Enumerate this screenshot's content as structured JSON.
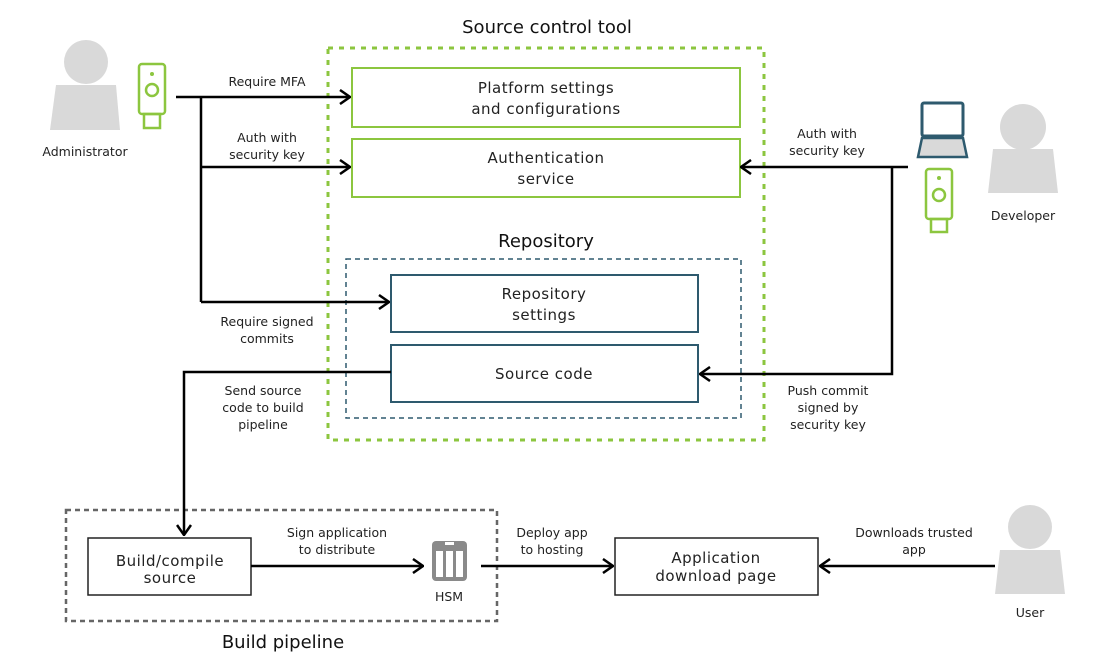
{
  "colors": {
    "green": "#8cc63f",
    "teal": "#2e5a6e",
    "gray_person": "#d9d9d9",
    "pipeline_border": "#666666",
    "hsm": "#8a8a8a"
  },
  "source_control": {
    "title": "Source control tool",
    "platform": [
      "Platform settings",
      "and configurations"
    ],
    "auth": [
      "Authentication",
      "service"
    ],
    "repository": {
      "title": "Repository",
      "settings": [
        "Repository",
        "settings"
      ],
      "source_code": "Source code"
    }
  },
  "build": {
    "title": "Build pipeline",
    "compile": [
      "Build/compile",
      "source"
    ],
    "hsm": "HSM"
  },
  "app_page": [
    "Application",
    "download page"
  ],
  "actors": {
    "admin": "Administrator",
    "developer": "Developer",
    "user": "User"
  },
  "edges": {
    "require_mfa": "Require MFA",
    "admin_auth": [
      "Auth with",
      "security key"
    ],
    "signed_commits": [
      "Require signed",
      "commits"
    ],
    "dev_auth": [
      "Auth with",
      "security key"
    ],
    "push_commit": [
      "Push commit",
      "signed by",
      "security key"
    ],
    "send_source": [
      "Send source",
      "code to build",
      "pipeline"
    ],
    "sign_app": [
      "Sign application",
      "to distribute"
    ],
    "deploy": [
      "Deploy app",
      "to hosting"
    ],
    "downloads": [
      "Downloads trusted",
      "app"
    ]
  }
}
